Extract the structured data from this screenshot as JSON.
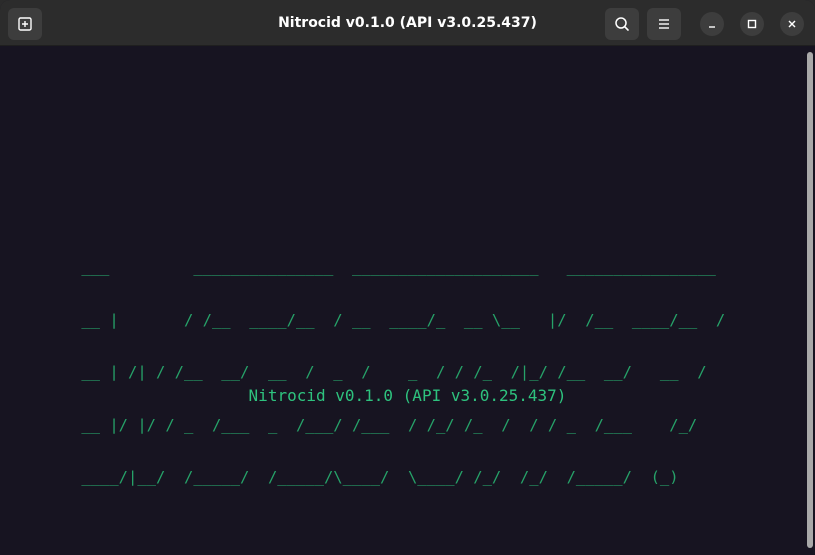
{
  "window": {
    "title": "Nitrocid v0.1.0 (API v3.0.25.437)"
  },
  "titlebar": {
    "new_tab_icon": "new-tab-icon",
    "search_icon": "search-icon",
    "menu_icon": "hamburger-menu-icon",
    "minimize_icon": "minimize-icon",
    "maximize_icon": "maximize-icon",
    "close_icon": "close-icon"
  },
  "terminal": {
    "banner_lines": [
      " ___         _______________  ____________________   ________________",
      " __ |       / /__  ____/__  / __  ____/_  __ \\__   |/  /__  ____/__  /",
      " __ | /| / /__  __/  __  /  _  /    _  / / /_  /|_/ /__  __/   __  / ",
      " __ |/ |/ / _  /___  _  /___/ /___  / /_/ /_  /  / / _  /___    /_/  ",
      " ____/|__/  /_____/  /_____/\\____/  \\____/ /_/  /_/  /_____/  (_)    "
    ],
    "version_line": "Nitrocid v0.1.0 (API v3.0.25.437)"
  },
  "colors": {
    "terminal_bg": "#171421",
    "banner_fg": "#26a269",
    "titlebar_bg": "#2c2c2c"
  }
}
